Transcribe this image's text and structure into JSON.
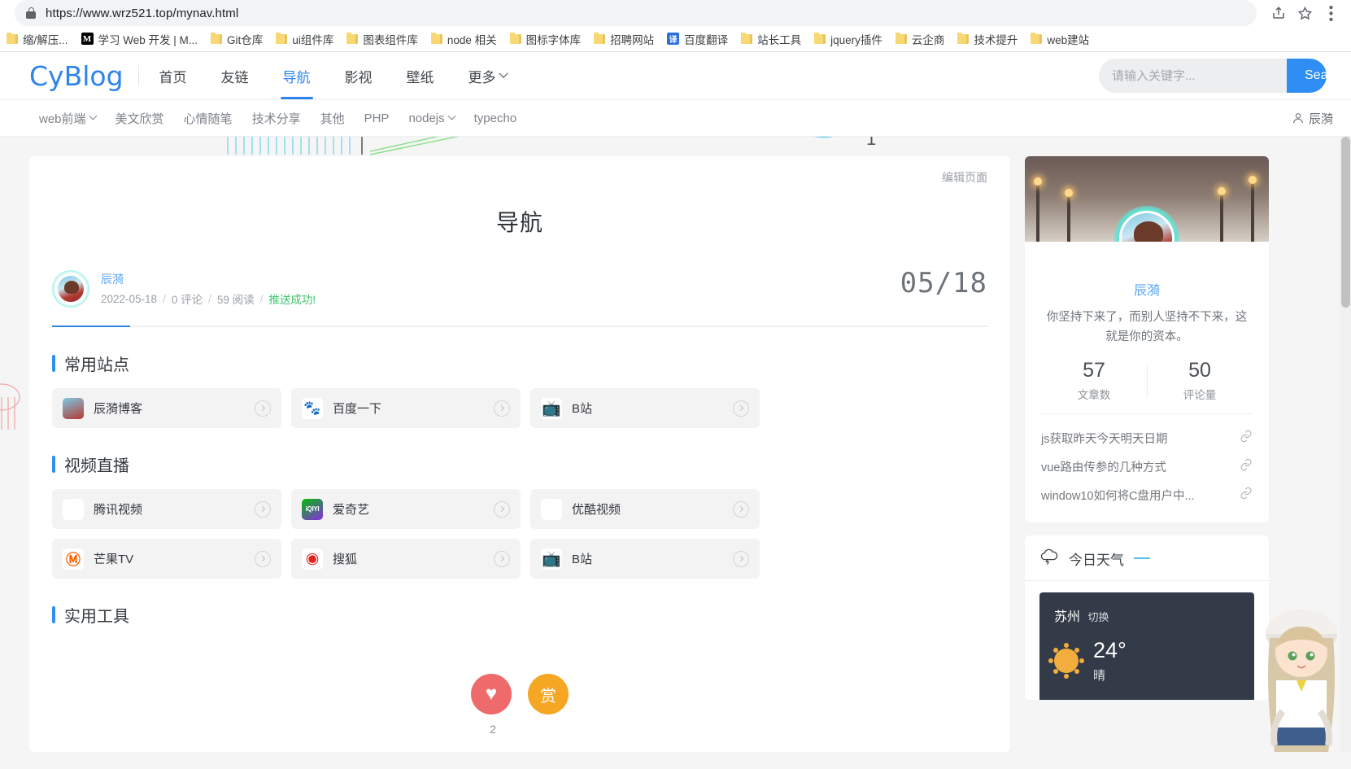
{
  "browser": {
    "url": "https://www.wrz521.top/mynav.html",
    "lock_icon": "lock-icon",
    "share_icon": "share-icon",
    "star_icon": "bookmark-star-icon",
    "menu_icon": "more-menu-icon",
    "bookmarks": [
      {
        "label": "缩/解压...",
        "icon": "folder-icon",
        "type": "folder"
      },
      {
        "label": "学习 Web 开发 | M...",
        "icon": "mdn-icon",
        "type": "mdn"
      },
      {
        "label": "Git仓库",
        "icon": "folder-icon",
        "type": "folder"
      },
      {
        "label": "ui组件库",
        "icon": "folder-icon",
        "type": "folder"
      },
      {
        "label": "图表组件库",
        "icon": "folder-icon",
        "type": "folder"
      },
      {
        "label": "node 相关",
        "icon": "folder-icon",
        "type": "folder"
      },
      {
        "label": "图标字体库",
        "icon": "folder-icon",
        "type": "folder"
      },
      {
        "label": "招聘网站",
        "icon": "folder-icon",
        "type": "folder"
      },
      {
        "label": "百度翻译",
        "icon": "translate-icon",
        "type": "fanyi",
        "glyph": "译"
      },
      {
        "label": "站长工具",
        "icon": "folder-icon",
        "type": "folder"
      },
      {
        "label": "jquery插件",
        "icon": "folder-icon",
        "type": "folder"
      },
      {
        "label": "云企商",
        "icon": "folder-icon",
        "type": "folder"
      },
      {
        "label": "技术提升",
        "icon": "folder-icon",
        "type": "folder"
      },
      {
        "label": "web建站",
        "icon": "folder-icon",
        "type": "folder"
      }
    ]
  },
  "header": {
    "logo": "CyBlog",
    "nav": [
      {
        "label": "首页",
        "active": false,
        "caret": false
      },
      {
        "label": "友链",
        "active": false,
        "caret": false
      },
      {
        "label": "导航",
        "active": true,
        "caret": false
      },
      {
        "label": "影视",
        "active": false,
        "caret": false
      },
      {
        "label": "壁纸",
        "active": false,
        "caret": false
      },
      {
        "label": "更多",
        "active": false,
        "caret": true
      }
    ],
    "search": {
      "placeholder": "请输入关键字...",
      "value": "",
      "button": "Search"
    },
    "accent_color": "#2f8ef4"
  },
  "subnav": {
    "items": [
      {
        "label": "web前端",
        "caret": true
      },
      {
        "label": "美文欣赏",
        "caret": false
      },
      {
        "label": "心情随笔",
        "caret": false
      },
      {
        "label": "技术分享",
        "caret": false
      },
      {
        "label": "其他",
        "caret": false
      },
      {
        "label": "PHP",
        "caret": false
      },
      {
        "label": "nodejs",
        "caret": true
      },
      {
        "label": "typecho",
        "caret": false
      }
    ],
    "user": "辰漪"
  },
  "article": {
    "edit_link": "编辑页面",
    "title": "导航",
    "author": "辰漪",
    "date": "2022-05-18",
    "comments": "0 评论",
    "reads": "59 阅读",
    "push_status": "推送成功!",
    "date_badge": "05/18",
    "sections": [
      {
        "title": "常用站点",
        "cards": [
          {
            "label": "辰漪博客",
            "icon": "chenyi-avatar-icon",
            "variant": "ico-chenyi",
            "glyph": ""
          },
          {
            "label": "百度一下",
            "icon": "baidu-paw-icon",
            "variant": "ico-baidu",
            "glyph": "🐾"
          },
          {
            "label": "B站",
            "icon": "bilibili-icon",
            "variant": "ico-bili",
            "glyph": "📺"
          }
        ]
      },
      {
        "title": "视频直播",
        "cards": [
          {
            "label": "腾讯视频",
            "icon": "tencent-video-icon",
            "variant": "ico-tencent",
            "glyph": "▶"
          },
          {
            "label": "爱奇艺",
            "icon": "iqiyi-icon",
            "variant": "ico-iqiyi",
            "glyph": "iQIYI"
          },
          {
            "label": "优酷视频",
            "icon": "youku-icon",
            "variant": "ico-youku",
            "glyph": "▸"
          },
          {
            "label": "芒果TV",
            "icon": "mango-tv-icon",
            "variant": "ico-mango",
            "glyph": "Ⓜ"
          },
          {
            "label": "搜狐",
            "icon": "sohu-icon",
            "variant": "ico-sohu",
            "glyph": "◉"
          },
          {
            "label": "B站",
            "icon": "bilibili-icon",
            "variant": "ico-bili",
            "glyph": "📺"
          }
        ]
      },
      {
        "title": "实用工具",
        "cards": []
      }
    ],
    "like_glyph": "♥",
    "reward_glyph": "赏",
    "like_count": "2"
  },
  "sidebar": {
    "profile": {
      "name": "辰漪",
      "quote": "你坚持下来了，而别人坚持不下来，这就是你的资本。",
      "stats": [
        {
          "value": "57",
          "label": "文章数"
        },
        {
          "value": "50",
          "label": "评论量"
        }
      ],
      "links": [
        {
          "label": "js获取昨天今天明天日期",
          "icon": "link-chain-icon"
        },
        {
          "label": "vue路由传参的几种方式",
          "icon": "link-chain-icon"
        },
        {
          "label": "window10如何将C盘用户中...",
          "icon": "link-chain-icon"
        }
      ]
    },
    "weather": {
      "icon": "cloud-lightning-icon",
      "title": "今日天气",
      "city": "苏州",
      "switch_label": "切换",
      "temperature": "24°",
      "condition": "晴",
      "sun_icon": "sun-icon"
    }
  }
}
